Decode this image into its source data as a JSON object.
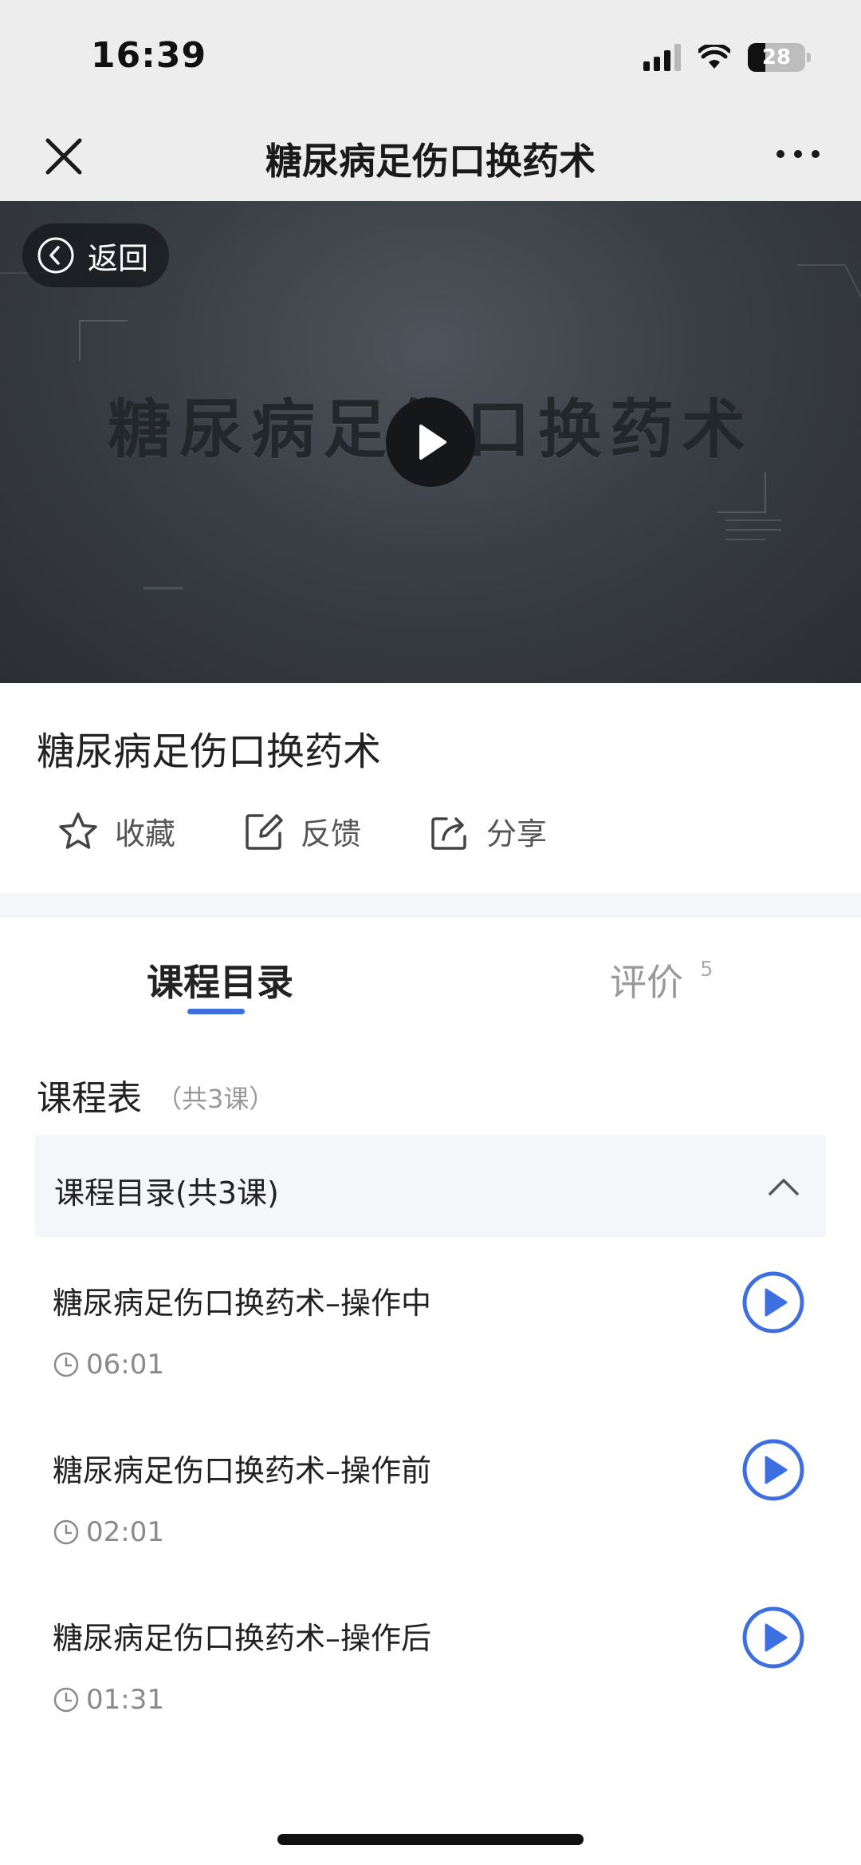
{
  "status_bar": {
    "time": "16:39",
    "battery": "28"
  },
  "nav": {
    "title": "糖尿病足伤口换药术"
  },
  "video": {
    "overlay_title": "糖尿病足伤口换药术",
    "back_label": "返回"
  },
  "course": {
    "title": "糖尿病足伤口换药术",
    "actions": [
      {
        "label": "收藏",
        "icon": "star-icon"
      },
      {
        "label": "反馈",
        "icon": "edit-icon"
      },
      {
        "label": "分享",
        "icon": "share-icon"
      }
    ]
  },
  "tabs": {
    "catalog": "课程目录",
    "reviews": "评价",
    "reviews_count": "5"
  },
  "schedule": {
    "title": "课程表",
    "count": "（共3课）",
    "section_label": "课程目录(共3课)",
    "lessons": [
      {
        "title": "糖尿病足伤口换药术–操作中",
        "duration": "06:01"
      },
      {
        "title": "糖尿病足伤口换药术–操作前",
        "duration": "02:01"
      },
      {
        "title": "糖尿病足伤口换药术–操作后",
        "duration": "01:31"
      }
    ]
  },
  "colors": {
    "accent": "#3d6fe0",
    "nav_bg": "#ededed",
    "section_bg": "#f5f6fa"
  }
}
